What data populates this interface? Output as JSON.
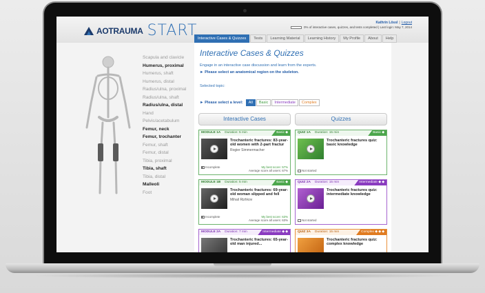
{
  "header": {
    "logo_text": "AOTRAUMA",
    "logo_start": "START",
    "user_name": "Kathrin Lössl",
    "logout_label": "Logout",
    "progress_text": "0% of interactive cases, quizzes, and tests completed | Last login: May 7, 2014",
    "progress_fraction": 0.0
  },
  "nav": {
    "tabs": [
      {
        "label": "Interactive Cases & Quizzes",
        "active": true
      },
      {
        "label": "Tests",
        "active": false
      },
      {
        "label": "Learning Material",
        "active": false
      },
      {
        "label": "Learning History",
        "active": false
      },
      {
        "label": "My Profile",
        "active": false
      },
      {
        "label": "About",
        "active": false
      },
      {
        "label": "Help",
        "active": false
      }
    ]
  },
  "regions": [
    {
      "label": "Scapula and clavicle",
      "bold": false
    },
    {
      "label": "Humerus, proximal",
      "bold": true
    },
    {
      "label": "Humerus, shaft",
      "bold": false
    },
    {
      "label": "Humerus, distal",
      "bold": false
    },
    {
      "label": "Radius/ulna, proximal",
      "bold": false
    },
    {
      "label": "Radius/ulna, shaft",
      "bold": false
    },
    {
      "label": "Radius/ulna, distal",
      "bold": true
    },
    {
      "label": "Hand",
      "bold": false
    },
    {
      "label": "Pelvis/acetabulum",
      "bold": false
    },
    {
      "label": "Femur, neck",
      "bold": true
    },
    {
      "label": "Femur, trochanter",
      "bold": true
    },
    {
      "label": "Femur, shaft",
      "bold": false
    },
    {
      "label": "Femur, distal",
      "bold": false
    },
    {
      "label": "Tibia, proximal",
      "bold": false
    },
    {
      "label": "Tibia, shaft",
      "bold": true
    },
    {
      "label": "Tibia, distal",
      "bold": false
    },
    {
      "label": "Malleoli",
      "bold": true
    },
    {
      "label": "Foot",
      "bold": false
    }
  ],
  "main": {
    "title": "Interactive Cases & Quizzes",
    "intro": "Engage in an interactive case discussion and learn from the experts.",
    "select_prompt": "► Please select an anatomical region on the skeleton.",
    "topic_label": "Selected topic:",
    "level_label": "► Please select a level:",
    "levels": [
      "All",
      "Basic",
      "Intermediate",
      "Complex"
    ],
    "col_cases": "Interactive Cases",
    "col_quizzes": "Quizzes"
  },
  "cards": {
    "case1": {
      "module": "MODULE 1A",
      "duration": "Duration: 5 min",
      "level": "Basic ◆",
      "title": "Trochanteric fractures: 83-year-old women with 2-part fractur",
      "author": "Rogier Simmermacher",
      "status": "Incomplete",
      "best": "My best score: 57%",
      "avg": "Average score all users: 67%"
    },
    "quiz1": {
      "module": "QUIZ 1A",
      "duration": "Duration: 15 min",
      "level": "Basic ◆",
      "title": "Trochanteric fractures quiz: basic knowledge",
      "status": "Not started"
    },
    "case2": {
      "module": "MODULE 1B",
      "duration": "Duration: 5 min",
      "level": "Basic ◆",
      "title": "Trochanteric fractures: 69-year-old woman slipped and fell",
      "author": "Mihail Rizhkov",
      "status": "Incomplete",
      "best": "My best score: 63%",
      "avg": "Average score all users: 63%"
    },
    "quiz2": {
      "module": "QUIZ 2A",
      "duration": "Duration: 15 min",
      "level": "Intermediate ◆ ◆",
      "title": "Trochanteric fractures quiz: intermediate knowledge",
      "status": "Not started"
    },
    "case3": {
      "module": "MODULE 2A",
      "duration": "Duration: 7 min",
      "level": "Intermediate ◆ ◆",
      "title": "Trochanteric fractures: 65-year-old man injured..."
    },
    "quiz3": {
      "module": "QUIZ 3A",
      "duration": "Duration: 15 min",
      "level": "Complex ◆ ◆ ◆",
      "title": "Trochanteric fractures quiz: complex knowledge"
    }
  },
  "colors": {
    "brand": "#2f6fb3",
    "basic": "#4ca64c",
    "intermediate": "#8a3bbf",
    "complex": "#e07b20"
  }
}
